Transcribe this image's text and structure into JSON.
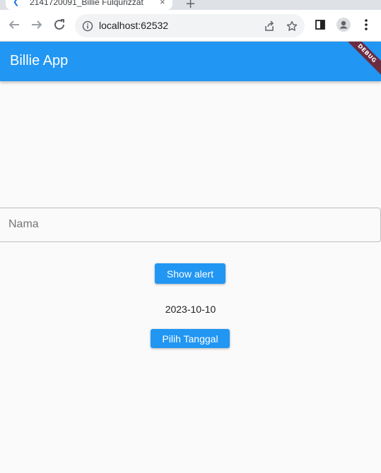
{
  "browser": {
    "tab_title": "2141720091_Billie Fulqurizzat",
    "tab_close": "×",
    "new_tab": "+",
    "url": "localhost:62532",
    "icons": [
      "back-arrow-icon",
      "forward-arrow-icon",
      "reload-icon",
      "info-icon",
      "share-icon",
      "star-icon",
      "side-panel-icon",
      "profile-icon",
      "menu-dots-icon"
    ]
  },
  "app": {
    "title": "Billie App",
    "debug_label": "DEBUG",
    "primary_color": "#2196f3"
  },
  "form": {
    "name_placeholder": "Nama",
    "name_value": ""
  },
  "actions": {
    "show_alert_label": "Show alert",
    "pick_date_label": "Pilih Tanggal"
  },
  "selected_date": "2023-10-10"
}
